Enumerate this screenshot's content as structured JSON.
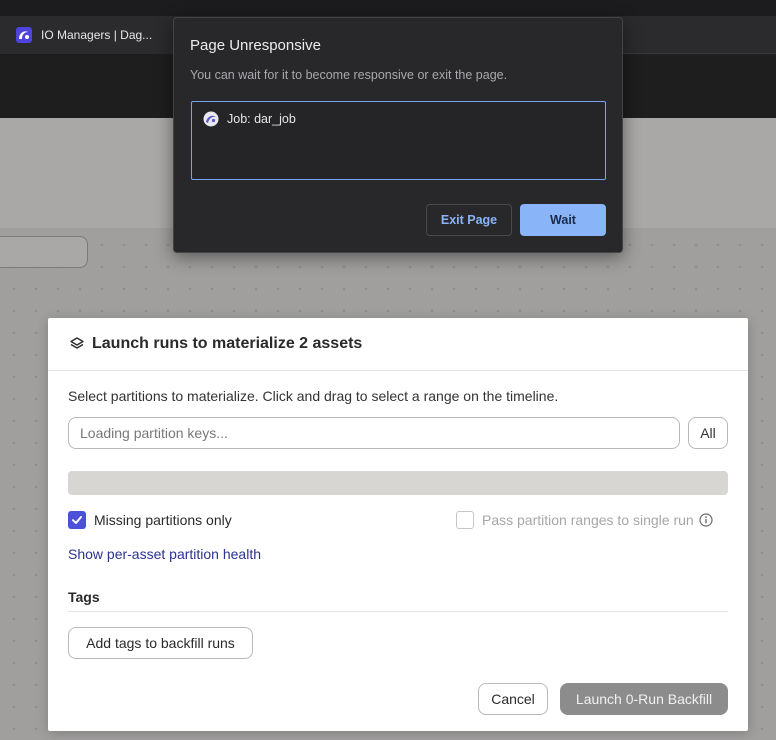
{
  "browser": {
    "tab_title": "IO Managers | Dag..."
  },
  "unresponsive_dialog": {
    "title": "Page Unresponsive",
    "message": "You can wait for it to become responsive or exit the page.",
    "pages": [
      "Job: dar_job"
    ],
    "exit_label": "Exit Page",
    "wait_label": "Wait"
  },
  "launch_dialog": {
    "title": "Launch runs to materialize 2 assets",
    "instructions": "Select partitions to materialize. Click and drag to select a range on the timeline.",
    "partition_input": {
      "placeholder": "Loading partition keys...",
      "value": ""
    },
    "all_label": "All",
    "missing_only": {
      "label": "Missing partitions only",
      "checked": true
    },
    "pass_ranges": {
      "label": "Pass partition ranges to single run",
      "checked": false,
      "disabled": true
    },
    "health_link": "Show per-asset partition health",
    "tags_heading": "Tags",
    "add_tags_label": "Add tags to backfill runs",
    "cancel_label": "Cancel",
    "launch_label": "Launch 0-Run Backfill"
  },
  "colors": {
    "accent": "#4c51d9",
    "link": "#2a3391",
    "chrome_primary": "#8ab4f8",
    "launch_disabled": "#8c8c8c"
  },
  "icons": [
    "dagster-favicon-icon",
    "layers-icon",
    "checkmark-icon",
    "info-icon",
    "dagster-logo-icon"
  ]
}
